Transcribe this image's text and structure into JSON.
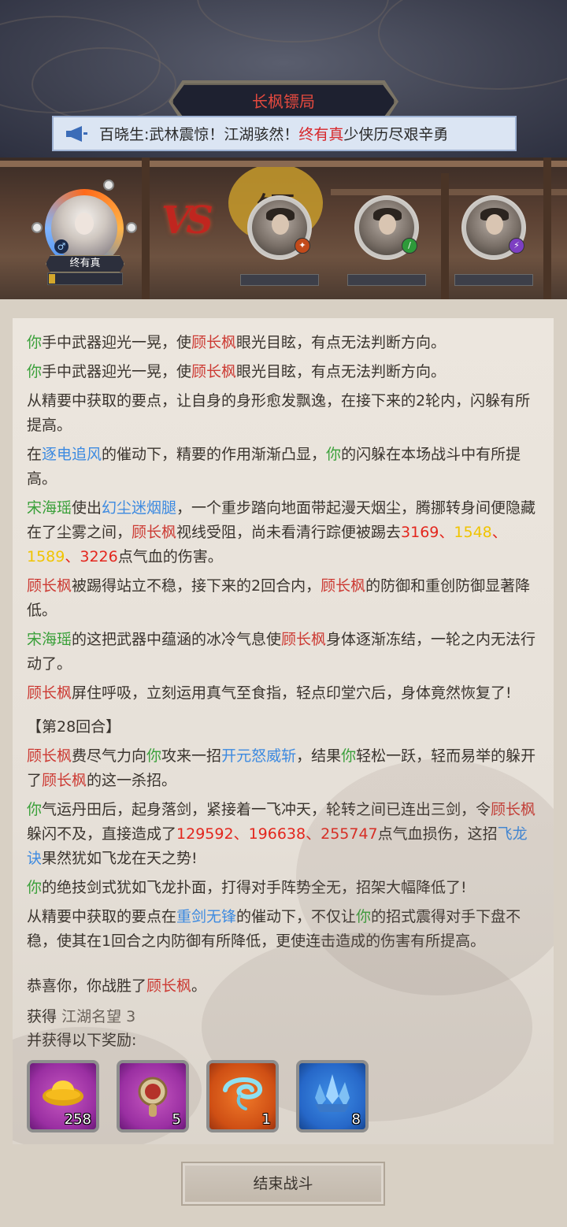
{
  "header": {
    "title": "长枫镖局",
    "ticker_prefix": "百晓生:武林震惊！江湖骇然！",
    "ticker_highlight": "终有真",
    "ticker_suffix": "少侠历尽艰辛勇"
  },
  "battle": {
    "player_name": "终有真",
    "player_bar_fraction": 0.08,
    "enemy_badges": [
      "fire-badge-icon",
      "wind-badge-icon",
      "thunder-badge-icon"
    ]
  },
  "log": {
    "line1": {
      "a": "你",
      "b": "手中武器迎光一晃，使",
      "c": "顾长枫",
      "d": "眼光目眩，有点无法判断方向。"
    },
    "line2": {
      "a": "你",
      "b": "手中武器迎光一晃，使",
      "c": "顾长枫",
      "d": "眼光目眩，有点无法判断方向。"
    },
    "line3": "从精要中获取的要点，让自身的身形愈发飘逸，在接下来的2轮内，闪躲有所提高。",
    "line4": {
      "a": "在",
      "b": "逐电追风",
      "c": "的催动下，精要的作用渐渐凸显，",
      "d": "你",
      "e": "的闪躲在本场战斗中有所提高。"
    },
    "line5": {
      "a": "宋海瑶",
      "b": "使出",
      "c": "幻尘迷烟腿",
      "d": "，一个重步踏向地面带起漫天烟尘，腾挪转身间便隐藏在了尘雾之间，",
      "e": "顾长枫",
      "f": "视线受阻，尚未看清行踪便被踢去",
      "n1": "3169",
      "s1": "、",
      "n2": "1548",
      "s2": "、",
      "n3": "1589",
      "s3": "、",
      "n4": "3226",
      "g": "点气血的伤害。"
    },
    "line6": {
      "a": "顾长枫",
      "b": "被踢得站立不稳，接下来的2回合内，",
      "c": "顾长枫",
      "d": "的防御和重创防御显著降低。"
    },
    "line7": {
      "a": "宋海瑶",
      "b": "的这把武器中蕴涵的冰冷气息使",
      "c": "顾长枫",
      "d": "身体逐渐冻结，一轮之内无法行动了。"
    },
    "line8": {
      "a": "顾长枫",
      "b": "屏住呼吸，立刻运用真气至食指，轻点印堂穴后，身体竟然恢复了!"
    },
    "round": "【第28回合】",
    "line9": {
      "a": "顾长枫",
      "b": "费尽气力向",
      "c": "你",
      "d": "攻来一招",
      "e": "开元怒威斩",
      "f": "，结果",
      "g": "你",
      "h": "轻松一跃，轻而易举的躲开了",
      "i": "顾长枫",
      "j": "的这一杀招。"
    },
    "line10": {
      "a": "你",
      "b": "气运丹田后，起身落剑，紧接着一飞冲天，轮转之间已连出三剑，令",
      "c": "顾长枫",
      "d": "躲闪不及，直接造成了",
      "n1": "129592",
      "s1": "、",
      "n2": "196638",
      "s2": "、",
      "n3": "255747",
      "e": "点气血损伤，这招",
      "f": "飞龙诀",
      "g": "果然犹如飞龙在天之势!"
    },
    "line11": {
      "a": "你",
      "b": "的绝技剑式犹如飞龙扑面，打得对手阵势全无，招架大幅降低了!"
    },
    "line12": {
      "a": "从精要中获取的要点在",
      "b": "重剑无锋",
      "c": "的催动下，不仅让",
      "d": "你",
      "e": "的招式震得对手下盘不稳，使其在1回合之内防御有所降低，更使连击造成的伤害有所提高。"
    },
    "victory": {
      "a": "恭喜你，你战胜了",
      "b": "顾长枫",
      "c": "。"
    }
  },
  "rewards": {
    "gain_label": "获得",
    "gain_value": "江湖名望 3",
    "extra_label": "并获得以下奖励:",
    "items": [
      {
        "icon": "gold-ingot-icon",
        "count": "258",
        "rarity": "purple"
      },
      {
        "icon": "escort-token-icon",
        "count": "5",
        "rarity": "purple"
      },
      {
        "icon": "spirit-swirl-icon",
        "count": "1",
        "rarity": "orange"
      },
      {
        "icon": "crystal-icon",
        "count": "8",
        "rarity": "blue"
      }
    ]
  },
  "footer": {
    "end_button": "结束战斗"
  }
}
